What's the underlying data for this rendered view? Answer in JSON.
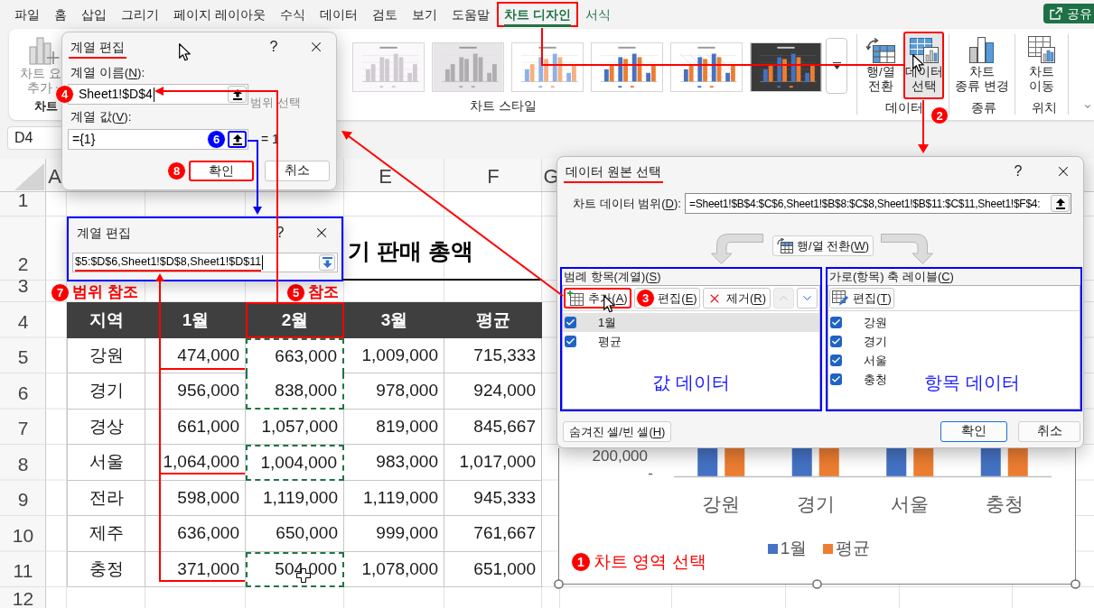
{
  "menu_tabs": [
    {
      "label": "파일",
      "selected": false,
      "contextual": false,
      "outlined": false
    },
    {
      "label": "홈",
      "selected": false,
      "contextual": false,
      "outlined": false
    },
    {
      "label": "삽입",
      "selected": false,
      "contextual": false,
      "outlined": false
    },
    {
      "label": "그리기",
      "selected": false,
      "contextual": false,
      "outlined": false
    },
    {
      "label": "페이지 레이아웃",
      "selected": false,
      "contextual": false,
      "outlined": false
    },
    {
      "label": "수식",
      "selected": false,
      "contextual": false,
      "outlined": false
    },
    {
      "label": "데이터",
      "selected": false,
      "contextual": false,
      "outlined": false
    },
    {
      "label": "검토",
      "selected": false,
      "contextual": false,
      "outlined": false
    },
    {
      "label": "보기",
      "selected": false,
      "contextual": false,
      "outlined": false
    },
    {
      "label": "도움말",
      "selected": false,
      "contextual": false,
      "outlined": false
    },
    {
      "label": "차트 디자인",
      "selected": true,
      "contextual": true,
      "outlined": true
    },
    {
      "label": "서식",
      "selected": false,
      "contextual": true,
      "outlined": false
    }
  ],
  "share_button": {
    "label": "공유"
  },
  "ribbon": {
    "chart_elements_button": {
      "lines": [
        "차트 요",
        "추가"
      ],
      "disabled": true
    },
    "first_group_label": "차트",
    "styles_group_label": "차트 스타일",
    "groups": [
      {
        "label": "데이터",
        "buttons": [
          {
            "kind": "switch",
            "lines": [
              "행/열",
              "전환"
            ],
            "hovered": false,
            "outlined": false
          },
          {
            "kind": "select",
            "lines": [
              "데이터",
              "선택"
            ],
            "hovered": true,
            "outlined": true,
            "badge": {
              "number": "2",
              "color": "#ff0000"
            }
          }
        ]
      },
      {
        "label": "종류",
        "buttons": [
          {
            "kind": "type",
            "lines": [
              "차트",
              "종류 변경"
            ],
            "hovered": false,
            "outlined": false
          }
        ]
      },
      {
        "label": "위치",
        "buttons": [
          {
            "kind": "move",
            "lines": [
              "차트",
              "이동"
            ],
            "hovered": false,
            "outlined": false
          }
        ]
      }
    ]
  },
  "series_dialog": {
    "title": {
      "text": "계열 편집",
      "underlined": true
    },
    "help": "?",
    "name_label": "계열 이름(N):",
    "name_field": {
      "value": "Sheet1!$D$4",
      "caret": true,
      "badge": {
        "number": "4",
        "color": "#ff0000"
      },
      "button_outlined": false
    },
    "name_hint": "범위 선택",
    "values_label": "계열 값(V):",
    "values_field": {
      "value": "={1}",
      "caret": false,
      "badge": {
        "number": "6",
        "color": "#0000ff"
      },
      "button_outlined": true
    },
    "values_result": "= 1",
    "buttons": [
      {
        "label": "확인",
        "outlined": true,
        "badge": {
          "number": "8",
          "color": "#ff0000"
        }
      },
      {
        "label": "취소",
        "outlined": false
      }
    ]
  },
  "name_box": "D4",
  "collapsed_dialog": {
    "title": {
      "text": "계열 편집",
      "underlined": false
    },
    "help": "?",
    "outlined": true,
    "field": {
      "value": "$5:$D$6,Sheet1!$D$8,Sheet1!$D$11",
      "caret": true,
      "underlined": true
    }
  },
  "data_source_dialog": {
    "title": {
      "text": "데이터 원본 선택",
      "underlined": true
    },
    "help": "?",
    "range_label": "차트 데이터 범위(D):",
    "range_value": "=Sheet1!$B$4:$C$6,Sheet1!$B$8:$C$8,Sheet1!$B$11:$C$11,Sheet1!$F$4:",
    "switch_button": "행/열 전환(W)",
    "legend_panel": {
      "title": "범례 항목(계열)(S)",
      "outlined": true,
      "buttons": [
        {
          "kind": "add",
          "label": "추가(A)",
          "outlined": true,
          "disabled": false
        },
        {
          "kind": "edit",
          "label": "편집(E)",
          "outlined": false,
          "disabled": false,
          "badge": {
            "number": "3",
            "color": "#ff0000"
          }
        },
        {
          "kind": "remove",
          "label": "제거(R)",
          "outlined": false,
          "disabled": false
        },
        {
          "kind": "up",
          "outlined": false,
          "disabled": true
        },
        {
          "kind": "down",
          "outlined": false,
          "disabled": false
        }
      ],
      "items": [
        {
          "label": "1월",
          "checked": true,
          "selected": true
        },
        {
          "label": "평균",
          "checked": true,
          "selected": false
        }
      ],
      "note": "값 데이터"
    },
    "axis_panel": {
      "title": "가로(항목) 축 레이블(C)",
      "outlined": true,
      "buttons": [
        {
          "kind": "edit",
          "label": "편집(T)",
          "outlined": false,
          "disabled": false
        }
      ],
      "items": [
        {
          "label": "강원",
          "checked": true,
          "selected": false
        },
        {
          "label": "경기",
          "checked": true,
          "selected": false
        },
        {
          "label": "서울",
          "checked": true,
          "selected": false
        },
        {
          "label": "충청",
          "checked": true,
          "selected": false
        }
      ],
      "note": "항목 데이터"
    },
    "hidden_cells_button": "숨겨진 셀/빈 셀(H)",
    "buttons": [
      {
        "label": "확인",
        "default": true
      },
      {
        "label": "취소",
        "default": false
      }
    ]
  },
  "sheet": {
    "column_headers": [
      "A",
      "E",
      "F",
      "G"
    ],
    "row_numbers": [
      "1",
      "2",
      "3",
      "4",
      "5",
      "6",
      "7",
      "8",
      "9",
      "10",
      "11",
      "12"
    ],
    "title": "기 판매 총액",
    "table": {
      "columns": [
        {
          "label": "지역",
          "outlined": false
        },
        {
          "label": "1월",
          "outlined": false
        },
        {
          "label": "2월",
          "outlined": true
        },
        {
          "label": "3월",
          "outlined": false
        },
        {
          "label": "평균",
          "outlined": false
        }
      ],
      "rows": [
        {
          "cells": [
            {
              "text": "강원",
              "highlighted": false
            },
            {
              "text": "474,000",
              "highlighted": false
            },
            {
              "text": "663,000",
              "highlighted": true
            },
            {
              "text": "1,009,000",
              "highlighted": false
            },
            {
              "text": "715,333",
              "highlighted": false
            }
          ]
        },
        {
          "cells": [
            {
              "text": "경기",
              "highlighted": false
            },
            {
              "text": "956,000",
              "highlighted": false
            },
            {
              "text": "838,000",
              "highlighted": true
            },
            {
              "text": "978,000",
              "highlighted": false
            },
            {
              "text": "924,000",
              "highlighted": false
            }
          ]
        },
        {
          "cells": [
            {
              "text": "경상",
              "highlighted": false
            },
            {
              "text": "661,000",
              "highlighted": false
            },
            {
              "text": "1,057,000",
              "highlighted": false
            },
            {
              "text": "819,000",
              "highlighted": false
            },
            {
              "text": "845,667",
              "highlighted": false
            }
          ]
        },
        {
          "cells": [
            {
              "text": "서울",
              "highlighted": false
            },
            {
              "text": "1,064,000",
              "highlighted": false
            },
            {
              "text": "1,004,000",
              "highlighted": true
            },
            {
              "text": "983,000",
              "highlighted": false
            },
            {
              "text": "1,017,000",
              "highlighted": false
            }
          ]
        },
        {
          "cells": [
            {
              "text": "전라",
              "highlighted": false
            },
            {
              "text": "598,000",
              "highlighted": false
            },
            {
              "text": "1,119,000",
              "highlighted": false
            },
            {
              "text": "1,119,000",
              "highlighted": false
            },
            {
              "text": "945,333",
              "highlighted": false
            }
          ]
        },
        {
          "cells": [
            {
              "text": "제주",
              "highlighted": false
            },
            {
              "text": "636,000",
              "highlighted": false
            },
            {
              "text": "650,000",
              "highlighted": false
            },
            {
              "text": "999,000",
              "highlighted": false
            },
            {
              "text": "761,667",
              "highlighted": false
            }
          ]
        },
        {
          "cells": [
            {
              "text": "충정",
              "highlighted": false
            },
            {
              "text": "371,000",
              "highlighted": false
            },
            {
              "text": "504,000",
              "highlighted": true
            },
            {
              "text": "1,078,000",
              "highlighted": false
            },
            {
              "text": "651,000",
              "highlighted": false
            }
          ]
        }
      ]
    }
  },
  "chart": {
    "selected": true,
    "y_axis_labels": [
      "200,000",
      "-"
    ],
    "categories": [
      "강원",
      "경기",
      "서울",
      "충청"
    ],
    "legend": [
      {
        "label": "1월",
        "color": "#4472c4"
      },
      {
        "label": "평균",
        "color": "#ed7d31"
      }
    ]
  },
  "callouts": [
    {
      "badge": {
        "number": "7",
        "color": "#ff0000"
      },
      "text": "범위 참조"
    },
    {
      "badge": {
        "number": "5",
        "color": "#ff0000"
      },
      "text": "참조"
    },
    {
      "badge": {
        "number": "1",
        "color": "#ff0000"
      },
      "text": "차트 영역 선택"
    }
  ]
}
